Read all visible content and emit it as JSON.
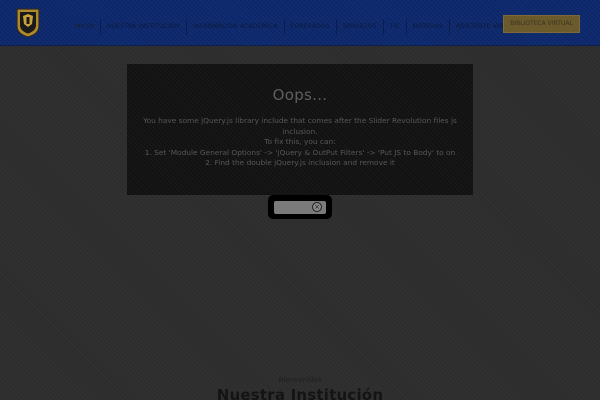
{
  "colors": {
    "header_bg": "#102c73",
    "cta_bg": "#6b5a2c",
    "page_bg": "#2d2d2d",
    "error_box_bg": "#121212"
  },
  "header": {
    "logo_icon": "shield-logo-icon",
    "nav": [
      {
        "label": "INICIO",
        "active": true
      },
      {
        "label": "NUESTRA INSTITUCIÓN"
      },
      {
        "label": "INFORMACIÓN ACADÉMICA"
      },
      {
        "label": "EGRESADOS"
      },
      {
        "label": "SERVICIOS"
      },
      {
        "label": "TIC"
      },
      {
        "label": "NOTICIAS"
      },
      {
        "label": "ASISTENTE VIRTUAL"
      }
    ],
    "cta_label": "BIBLIOTECA VIRTUAL"
  },
  "error": {
    "title": "Oops...",
    "line1": "You have some jQuery.js library include that comes after the Slider Revolution files js",
    "line2": "inclusion.",
    "line3": "To fix this, you can:",
    "line4": "1. Set 'Module General Options' -> 'jQuery & OutPut Filters' -> 'Put JS to Body' to on",
    "line5": "2. Find the double jQuery.js inclusion and remove it"
  },
  "popup": {
    "close_glyph": "×"
  },
  "section": {
    "kicker": "Bienvenidos",
    "title": "Nuestra Institución"
  }
}
